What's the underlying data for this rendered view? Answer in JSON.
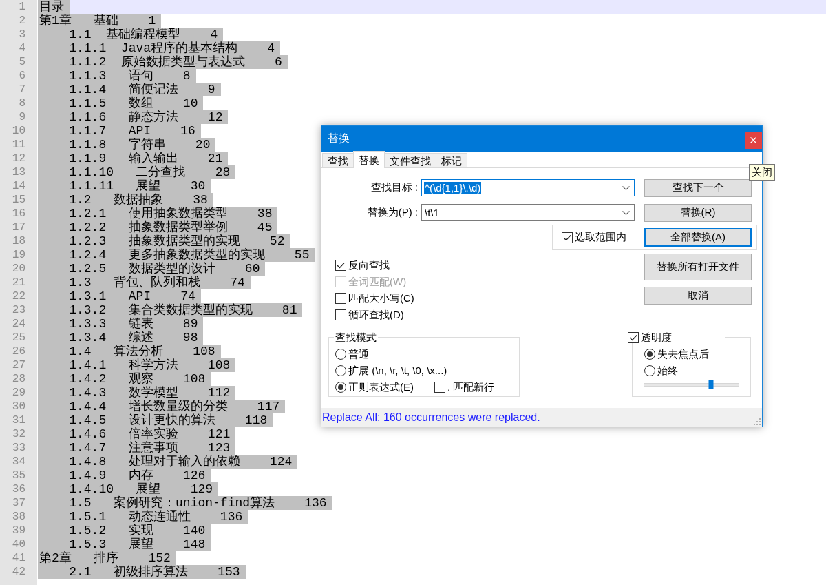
{
  "editor": {
    "lines": [
      {
        "number": "1",
        "text": "目录",
        "selected": true,
        "current": true
      },
      {
        "number": "2",
        "text": "第1章   基础    1",
        "selected": true,
        "current": false
      },
      {
        "number": "3",
        "text": "\t1.1  基础编程模型    4",
        "selected": true,
        "current": false
      },
      {
        "number": "4",
        "text": "\t1.1.1  Java程序的基本结构    4",
        "selected": true,
        "current": false
      },
      {
        "number": "5",
        "text": "\t1.1.2  原始数据类型与表达式    6",
        "selected": true,
        "current": false
      },
      {
        "number": "6",
        "text": "\t1.1.3   语句    8",
        "selected": true,
        "current": false
      },
      {
        "number": "7",
        "text": "\t1.1.4   简便记法    9",
        "selected": true,
        "current": false
      },
      {
        "number": "8",
        "text": "\t1.1.5   数组    10",
        "selected": true,
        "current": false
      },
      {
        "number": "9",
        "text": "\t1.1.6   静态方法    12",
        "selected": true,
        "current": false
      },
      {
        "number": "10",
        "text": "\t1.1.7   API    16",
        "selected": true,
        "current": false
      },
      {
        "number": "11",
        "text": "\t1.1.8   字符串    20",
        "selected": true,
        "current": false
      },
      {
        "number": "12",
        "text": "\t1.1.9   输入输出    21",
        "selected": true,
        "current": false
      },
      {
        "number": "13",
        "text": "\t1.1.10   二分查找    28",
        "selected": true,
        "current": false
      },
      {
        "number": "14",
        "text": "\t1.1.11   展望    30",
        "selected": true,
        "current": false
      },
      {
        "number": "15",
        "text": "\t1.2   数据抽象    38",
        "selected": true,
        "current": false
      },
      {
        "number": "16",
        "text": "\t1.2.1   使用抽象数据类型    38",
        "selected": true,
        "current": false
      },
      {
        "number": "17",
        "text": "\t1.2.2   抽象数据类型举例    45",
        "selected": true,
        "current": false
      },
      {
        "number": "18",
        "text": "\t1.2.3   抽象数据类型的实现    52",
        "selected": true,
        "current": false
      },
      {
        "number": "19",
        "text": "\t1.2.4   更多抽象数据类型的实现    55",
        "selected": true,
        "current": false
      },
      {
        "number": "20",
        "text": "\t1.2.5   数据类型的设计    60",
        "selected": true,
        "current": false
      },
      {
        "number": "21",
        "text": "\t1.3   背包、队列和栈    74",
        "selected": true,
        "current": false
      },
      {
        "number": "22",
        "text": "\t1.3.1   API    74",
        "selected": true,
        "current": false
      },
      {
        "number": "23",
        "text": "\t1.3.2   集合类数据类型的实现    81",
        "selected": true,
        "current": false
      },
      {
        "number": "24",
        "text": "\t1.3.3   链表    89",
        "selected": true,
        "current": false
      },
      {
        "number": "25",
        "text": "\t1.3.4   综述    98",
        "selected": true,
        "current": false
      },
      {
        "number": "26",
        "text": "\t1.4   算法分析    108",
        "selected": true,
        "current": false
      },
      {
        "number": "27",
        "text": "\t1.4.1   科学方法    108",
        "selected": true,
        "current": false
      },
      {
        "number": "28",
        "text": "\t1.4.2   观察    108",
        "selected": true,
        "current": false
      },
      {
        "number": "29",
        "text": "\t1.4.3   数学模型    112",
        "selected": true,
        "current": false
      },
      {
        "number": "30",
        "text": "\t1.4.4   增长数量级的分类    117",
        "selected": true,
        "current": false
      },
      {
        "number": "31",
        "text": "\t1.4.5   设计更快的算法    118",
        "selected": true,
        "current": false
      },
      {
        "number": "32",
        "text": "\t1.4.6   倍率实验    121",
        "selected": true,
        "current": false
      },
      {
        "number": "33",
        "text": "\t1.4.7   注意事项    123",
        "selected": true,
        "current": false
      },
      {
        "number": "34",
        "text": "\t1.4.8   处理对于输入的依赖    124",
        "selected": true,
        "current": false
      },
      {
        "number": "35",
        "text": "\t1.4.9   内存    126",
        "selected": true,
        "current": false
      },
      {
        "number": "36",
        "text": "\t1.4.10   展望    129",
        "selected": true,
        "current": false
      },
      {
        "number": "37",
        "text": "\t1.5   案例研究：union-find算法    136",
        "selected": true,
        "current": false
      },
      {
        "number": "38",
        "text": "\t1.5.1   动态连通性    136",
        "selected": true,
        "current": false
      },
      {
        "number": "39",
        "text": "\t1.5.2   实现    140",
        "selected": true,
        "current": false
      },
      {
        "number": "40",
        "text": "\t1.5.3   展望    148",
        "selected": true,
        "current": false
      },
      {
        "number": "41",
        "text": "第2章   排序    152",
        "selected": true,
        "current": false
      },
      {
        "number": "42",
        "text": "\t2.1   初级排序算法    153",
        "selected": true,
        "current": false
      }
    ]
  },
  "dialog": {
    "title": "替换",
    "close_tooltip": "关闭",
    "tabs": [
      {
        "label": "查找",
        "selected": false
      },
      {
        "label": "替换",
        "selected": true
      },
      {
        "label": "文件查找",
        "selected": false
      },
      {
        "label": "标记",
        "selected": false
      }
    ],
    "fields": [
      {
        "label": "查找目标 :",
        "value": "^(\\d{1,1}\\.\\d)",
        "focused": true,
        "text_selected": true
      },
      {
        "label": "替换为(P) :",
        "value": "\\t\\1",
        "focused": false,
        "text_selected": false
      }
    ],
    "in_selection": {
      "label": "选取范围内",
      "checked": true
    },
    "buttons": [
      {
        "label": "查找下一个",
        "focused": false
      },
      {
        "label": "替换(R)",
        "focused": false
      },
      {
        "label": "全部替换(A)",
        "focused": true
      },
      {
        "label": "替换所有打开文件",
        "focused": false
      },
      {
        "label": "取消",
        "focused": false
      }
    ],
    "options": [
      {
        "label": "反向查找",
        "checked": true,
        "disabled": false
      },
      {
        "label": "全词匹配(W)",
        "checked": false,
        "disabled": true
      },
      {
        "label": "匹配大小写(C)",
        "checked": false,
        "disabled": false
      },
      {
        "label": "循环查找(D)",
        "checked": false,
        "disabled": false
      }
    ],
    "search_mode": {
      "title": "查找模式",
      "modes": [
        {
          "label": "普通",
          "selected": false
        },
        {
          "label": "扩展 (\\n, \\r, \\t, \\0, \\x...)",
          "selected": false
        },
        {
          "label": "正则表达式(E)",
          "selected": true
        }
      ],
      "dot_newline": {
        "label": ". 匹配新行",
        "checked": false
      }
    },
    "transparency": {
      "label": "透明度",
      "checked": true,
      "modes": [
        {
          "label": "失去焦点后",
          "selected": true
        },
        {
          "label": "始终",
          "selected": false
        }
      ],
      "level": 0.71
    },
    "status": "Replace All: 160 occurrences were replaced."
  }
}
